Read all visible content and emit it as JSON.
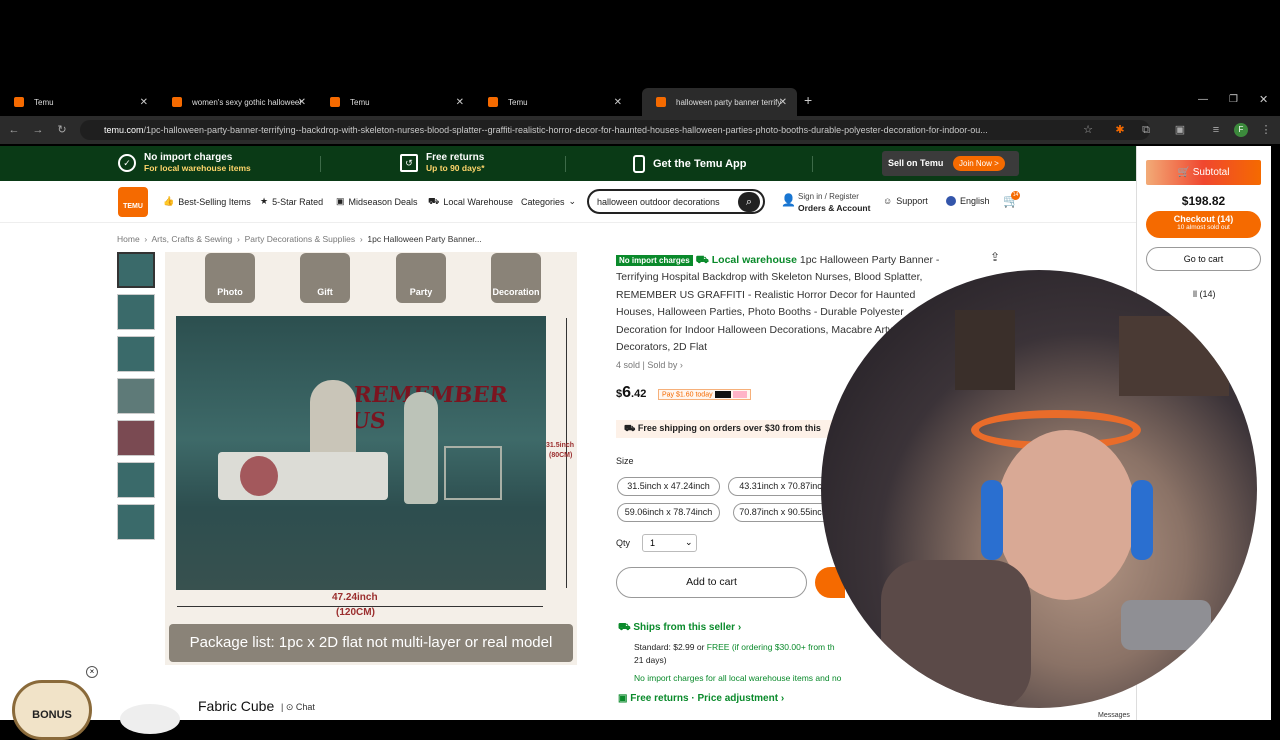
{
  "browser": {
    "tabs": [
      {
        "title": "Temu"
      },
      {
        "title": "women's sexy gothic halloween"
      },
      {
        "title": "Temu"
      },
      {
        "title": "Temu"
      },
      {
        "title": "halloween party banner terrifyi"
      }
    ],
    "url_host": "temu.com",
    "url_path": "/1pc-halloween-party-banner-terrifying--backdrop-with-skeleton-nurses-blood-splatter--graffiti-realistic-horror-decor-for-haunted-houses-halloween-parties-photo-booths-durable-polyester-decoration-for-indoor-ou..."
  },
  "promo": {
    "import_title": "No import charges",
    "import_sub": "For local warehouse items",
    "returns_title": "Free returns",
    "returns_sub": "Up to 90 days*",
    "app": "Get the Temu App",
    "sell": "Sell on Temu",
    "join": "Join Now >"
  },
  "header": {
    "nav": [
      "Best-Selling Items",
      "5-Star Rated",
      "Midseason Deals",
      "Local Warehouse",
      "Categories"
    ],
    "search_value": "halloween outdoor decorations",
    "signin": "Sign in / Register",
    "account": "Orders & Account",
    "support": "Support",
    "language": "English",
    "cart_count": "14"
  },
  "breadcrumb": [
    "Home",
    "Arts, Crafts & Sewing",
    "Party Decorations & Supplies",
    "1pc Halloween Party Banner..."
  ],
  "image": {
    "icons": [
      "Photo",
      "Gift",
      "Party",
      "Decoration"
    ],
    "banner_text": "REMEMBER US",
    "height_label": "31.5inch",
    "height_cm": "(80CM)",
    "width_label": "47.24inch",
    "width_cm": "(120CM)",
    "package": "Package list: 1pc x 2D flat not multi-layer or real model"
  },
  "seller": {
    "name": "Fabric Cube",
    "chat": "Chat"
  },
  "product": {
    "badge": "No import charges",
    "warehouse": "Local warehouse",
    "title": "1pc Halloween Party Banner - Terrifying Hospital Backdrop with Skeleton Nurses, Blood Splatter, REMEMBER US GRAFFITI - Realistic Horror Decor for Haunted Houses, Halloween Parties, Photo Booths - Durable Polyester Decoration for Indoor Halloween Decorations, Macabre Artwork, High Decorators, 2D Flat",
    "sold": "4 sold",
    "sold_by": "Sold by",
    "price_symbol": "$",
    "price_int": "6",
    "price_dec": ".42",
    "paylater": "Pay $1.60 today",
    "shipping": "Free shipping on orders over $30 from this",
    "size_label": "Size",
    "sizes": [
      "31.5inch x 47.24inch",
      "43.31inch x 70.87inch",
      "59.06inch x 78.74inch",
      "70.87inch x 90.55inch"
    ],
    "qty_label": "Qty",
    "qty_value": "1",
    "add_to_cart": "Add to cart",
    "ships_from": "Ships from this seller",
    "standard": "Standard: $2.99 or",
    "free_text": "FREE (if ordering $30.00+ from th",
    "days": "21 days)",
    "import_note": "No import charges for all local warehouse items and no",
    "free_returns": "Free returns · Price adjustment"
  },
  "cart": {
    "subtotal_label": "Subtotal",
    "subtotal": "$198.82",
    "checkout": "Checkout (14)",
    "sold_out": "10 almost sold out",
    "go_to_cart": "Go to cart",
    "all": "ll (14)"
  },
  "misc": {
    "bonus": "BONUS",
    "messages": "Messages"
  },
  "colors": {
    "brand": "#f56a00",
    "green": "#0a8a2b"
  }
}
